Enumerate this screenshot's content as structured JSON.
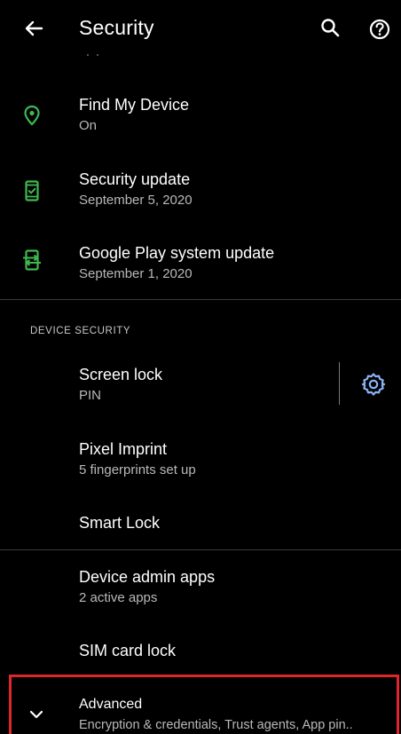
{
  "header": {
    "title": "Security",
    "back_icon": "arrow-left-icon",
    "search_icon": "search-icon",
    "help_icon": "help-icon"
  },
  "items": [
    {
      "title": "Find My Device",
      "subtitle": "On",
      "icon": "location-pin-icon",
      "icon_color": "#3fb950"
    },
    {
      "title": "Security update",
      "subtitle": "September 5, 2020",
      "icon": "phone-check-icon",
      "icon_color": "#3fb950"
    },
    {
      "title": "Google Play system update",
      "subtitle": "September 1, 2020",
      "icon": "phone-sync-icon",
      "icon_color": "#3fb950"
    }
  ],
  "device_security": {
    "header": "DEVICE SECURITY",
    "screen_lock": {
      "title": "Screen lock",
      "subtitle": "PIN",
      "settings_icon": "gear-icon",
      "settings_icon_color": "#8ab4f8"
    },
    "pixel_imprint": {
      "title": "Pixel Imprint",
      "subtitle": "5 fingerprints set up"
    },
    "smart_lock": {
      "title": "Smart Lock"
    }
  },
  "more_items": {
    "device_admin": {
      "title": "Device admin apps",
      "subtitle": "2 active apps"
    },
    "sim_lock": {
      "title": "SIM card lock"
    }
  },
  "advanced": {
    "title": "Advanced",
    "subtitle": "Encryption & credentials, Trust agents, App pin..",
    "icon": "chevron-down-icon",
    "highlight_color": "#e0252d"
  }
}
